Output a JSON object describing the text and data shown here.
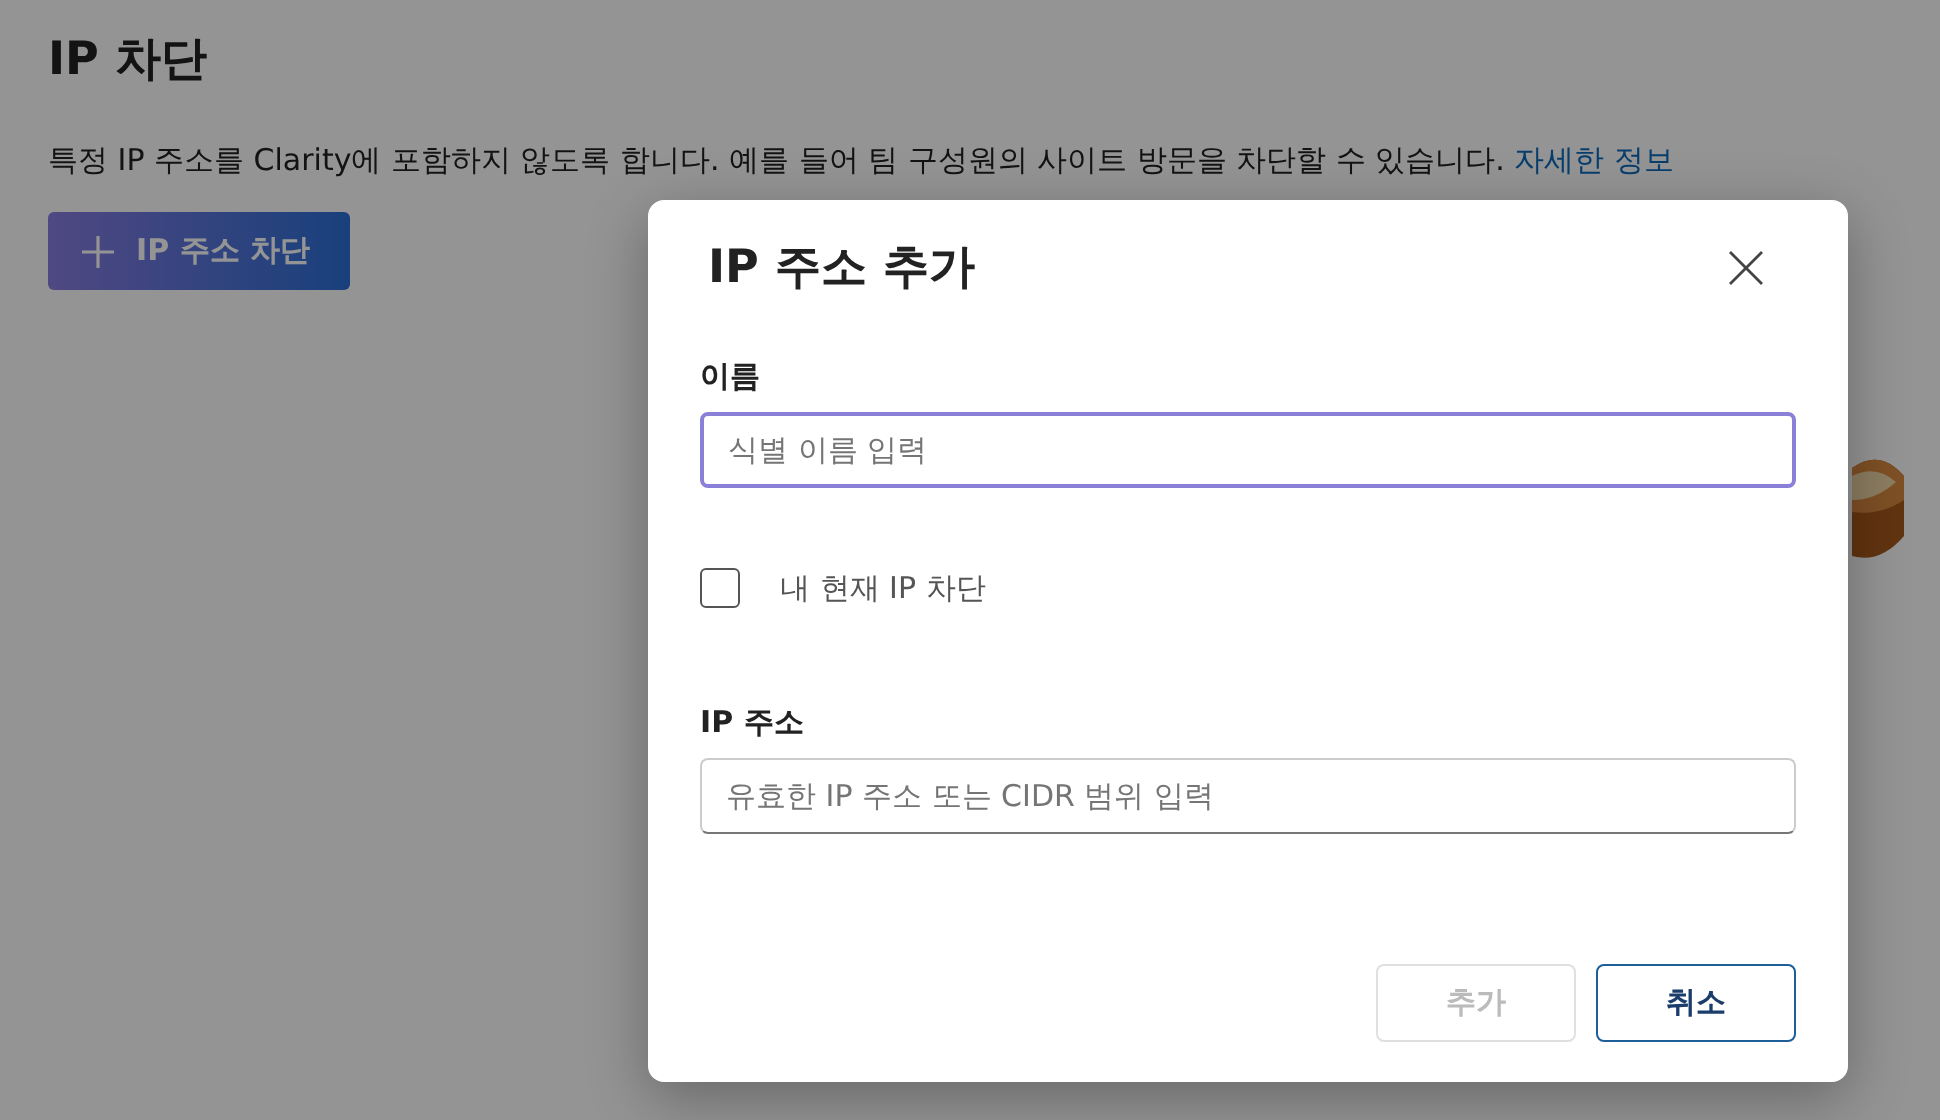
{
  "page": {
    "title": "IP 차단",
    "description": "특정 IP 주소를 Clarity에 포함하지 않도록 합니다. 예를 들어 팀 구성원의 사이트 방문을 차단할 수 있습니다.",
    "learn_more_link": "자세한 정보",
    "block_button": "IP 주소 차단"
  },
  "dialog": {
    "title": "IP 주소 추가",
    "fields": [
      {
        "kind": "text",
        "label": "이름",
        "placeholder": "식별 이름 입력",
        "focused": true
      },
      {
        "kind": "checkbox",
        "label": "내 현재 IP 차단",
        "checked": false
      },
      {
        "kind": "text",
        "label": "IP 주소",
        "placeholder": "유효한 IP 주소 또는 CIDR 범위 입력",
        "focused": false
      }
    ],
    "buttons": [
      {
        "label": "추가",
        "disabled": true
      },
      {
        "label": "취소",
        "disabled": false
      }
    ]
  }
}
